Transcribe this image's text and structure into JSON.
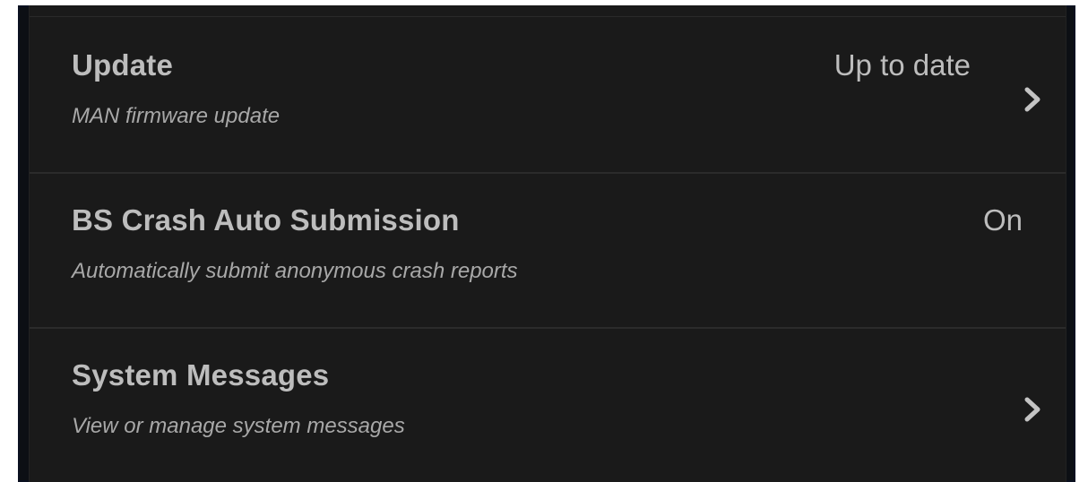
{
  "settings": {
    "rows": [
      {
        "title": "Update",
        "subtitle": "MAN firmware update",
        "value": "Up to date",
        "chevron_icon": "chevron-right-icon"
      },
      {
        "title": "BS Crash Auto Submission",
        "subtitle": "Automatically submit anonymous crash reports",
        "value": "On"
      },
      {
        "title": "System Messages",
        "subtitle": "View or manage system messages",
        "chevron_icon": "chevron-right-icon"
      }
    ]
  },
  "colors": {
    "background": "#1a1a1a",
    "text": "#bdbdbd",
    "subtext": "#a8a8a8",
    "divider": "#2b2b2b"
  }
}
